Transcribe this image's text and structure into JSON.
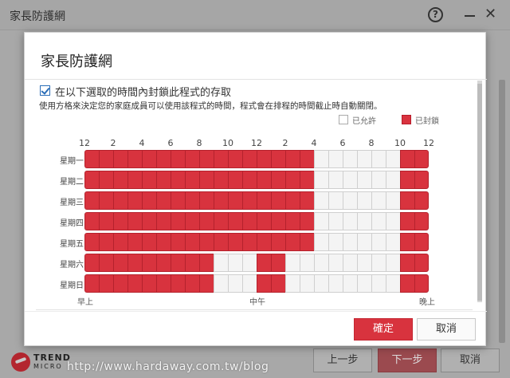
{
  "background_window": {
    "title": "家長防護網",
    "help_glyph": "?",
    "minimize_glyph": "—",
    "close_glyph": "✕",
    "logo_line1": "TREND",
    "logo_line2": "MICRO",
    "prev_label": "上一步",
    "next_label": "下一步",
    "cancel_label": "取消"
  },
  "watermark": "http://www.hardaway.com.tw/blog",
  "dialog": {
    "title": "家長防護網",
    "checkbox_checked": true,
    "checkbox_label": "在以下選取的時間內封鎖此程式的存取",
    "description": "使用方格來決定您的家庭成員可以使用該程式的時間，程式會在排程的時間截止時自動關閉。",
    "legend": {
      "allowed": "已允許",
      "blocked": "已封鎖"
    },
    "hour_labels": [
      "12",
      "2",
      "4",
      "6",
      "8",
      "10",
      "12",
      "2",
      "4",
      "6",
      "8",
      "10",
      "12"
    ],
    "period_labels": {
      "start": "早上",
      "middle": "中午",
      "end": "晚上"
    },
    "days": [
      {
        "label": "星期一",
        "slots": "111111111111111100000011"
      },
      {
        "label": "星期二",
        "slots": "111111111111111100000011"
      },
      {
        "label": "星期三",
        "slots": "111111111111111100000011"
      },
      {
        "label": "星期四",
        "slots": "111111111111111100000011"
      },
      {
        "label": "星期五",
        "slots": "111111111111111100000011"
      },
      {
        "label": "星期六",
        "slots": "111111111000110000000011"
      },
      {
        "label": "星期日",
        "slots": "111111111000110000000011"
      }
    ],
    "ok_label": "確定",
    "cancel_label": "取消"
  },
  "colors": {
    "blocked": "#d8333e",
    "allowed": "#f4f4f4",
    "accent": "#2a6db7"
  }
}
